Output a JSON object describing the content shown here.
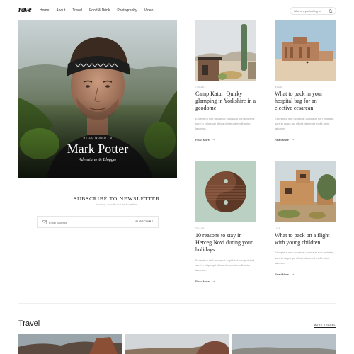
{
  "brand": {
    "logo": "rave"
  },
  "nav": {
    "items": [
      "Home",
      "About",
      "Travel",
      "Food & Drink",
      "Photography",
      "Video"
    ]
  },
  "search": {
    "placeholder": "What are you looking for"
  },
  "hero": {
    "kicker": "HELLO WORLD I'M",
    "name": "Mark Potter",
    "role": "Adventurer & Blogger"
  },
  "newsletter": {
    "title": "SUBSCRIBE TO NEWSLETTER",
    "subtitle": "No spam, actually, nr. Unsub anytime.",
    "placeholder": "Email Address",
    "button": "SUBSCRIBE"
  },
  "posts": [
    {
      "category": "TRAVEL",
      "title": "Camp Katur: Quirky glamping in Yorkshire in a geodome",
      "excerpt": "Excepteur sint occaecat cupidatat non proident, sunt in culpa qui officia deserunt mollit anim laborum.",
      "more": "Read More"
    },
    {
      "category": "BLOG",
      "title": "What to pack in your hospital bag for an elective cesarean",
      "excerpt": "Excepteur sint occaecat cupidatat non proident, sunt in culpa qui officia deserunt mollit anim laborum.",
      "more": "Read More"
    },
    {
      "category": "TRAVEL",
      "title": "10 reasons to stay in Herceg Novi during your holidays",
      "excerpt": "Excepteur sint occaecat cupidatat non proident, sunt in culpa qui officia deserunt mollit anim laborum.",
      "more": "Read More"
    },
    {
      "category": "LIFE",
      "title": "What to pack on a flight with young children",
      "excerpt": "Excepteur sint occaecat cupidatat non proident, sunt in culpa qui officia deserunt mollit anim laborum.",
      "more": "Read More"
    }
  ],
  "travel_section": {
    "heading": "Travel",
    "more": "MORE TRAVEL"
  },
  "icons": {
    "search": "search-icon",
    "mail": "mail-icon",
    "arrow": "arrow-right-icon"
  },
  "colors": {
    "text": "#222222",
    "muted": "#999999",
    "border": "#e6e6e6"
  }
}
